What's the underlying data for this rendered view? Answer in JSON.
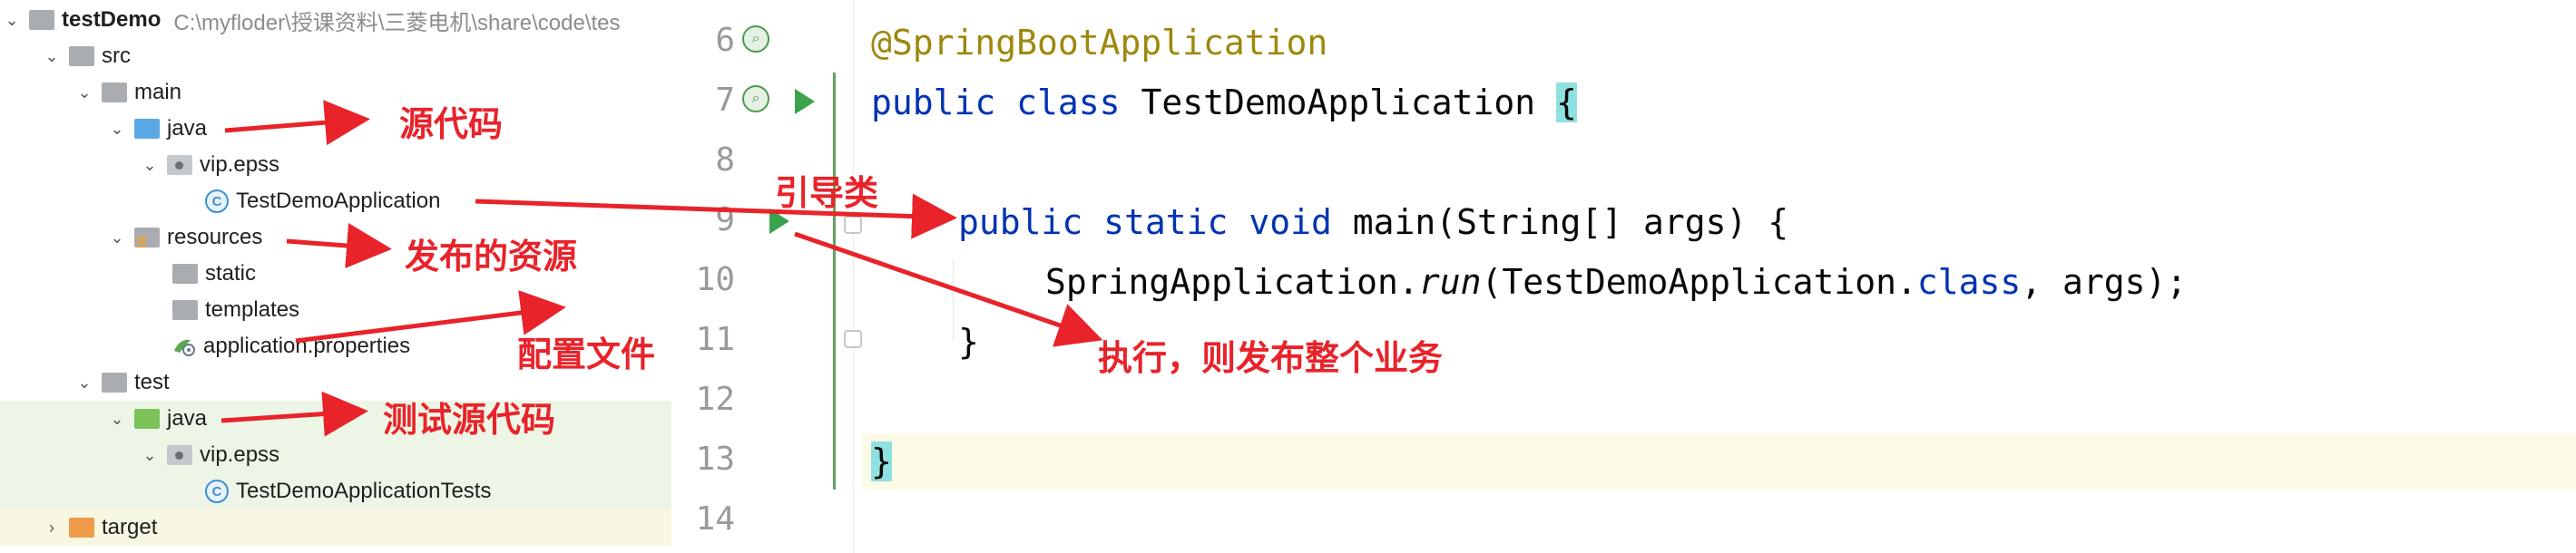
{
  "project": {
    "name": "testDemo",
    "path": "C:\\myfloder\\授课资料\\三菱电机\\share\\code\\tes"
  },
  "tree": [
    {
      "label": "src"
    },
    {
      "label": "main"
    },
    {
      "label": "java"
    },
    {
      "label": "vip.epss"
    },
    {
      "label": "TestDemoApplication"
    },
    {
      "label": "resources"
    },
    {
      "label": "static"
    },
    {
      "label": "templates"
    },
    {
      "label": "application.properties"
    },
    {
      "label": "test"
    },
    {
      "label": "java"
    },
    {
      "label": "vip.epss"
    },
    {
      "label": "TestDemoApplicationTests"
    },
    {
      "label": "target"
    }
  ],
  "editor": {
    "line_numbers": [
      "6",
      "7",
      "8",
      "9",
      "10",
      "11",
      "12",
      "13",
      "14"
    ],
    "code": {
      "l6_annotation": "@SpringBootApplication",
      "l7_kw1": "public",
      "l7_kw2": "class",
      "l7_name": "TestDemoApplication",
      "l7_brace": "{",
      "l9_kw1": "public",
      "l9_kw2": "static",
      "l9_kw3": "void",
      "l9_rest": "main(String[] args) {",
      "l10_a": "SpringApplication.",
      "l10_run": "run",
      "l10_b": "(TestDemoApplication.",
      "l10_class": "class",
      "l10_c": ", args);",
      "l11_brace": "}",
      "l13_brace": "}"
    }
  },
  "annotations": {
    "source_code": "源代码",
    "bootstrap_class": "引导类",
    "published_resources": "发布的资源",
    "config_file": "配置文件",
    "test_source": "测试源代码",
    "execute_note": "执行，则发布整个业务"
  },
  "colors": {
    "keyword": "#0033b3",
    "annotation": "#9e880d",
    "arrow": "#e8232a",
    "run_icon": "#3aa34b"
  }
}
